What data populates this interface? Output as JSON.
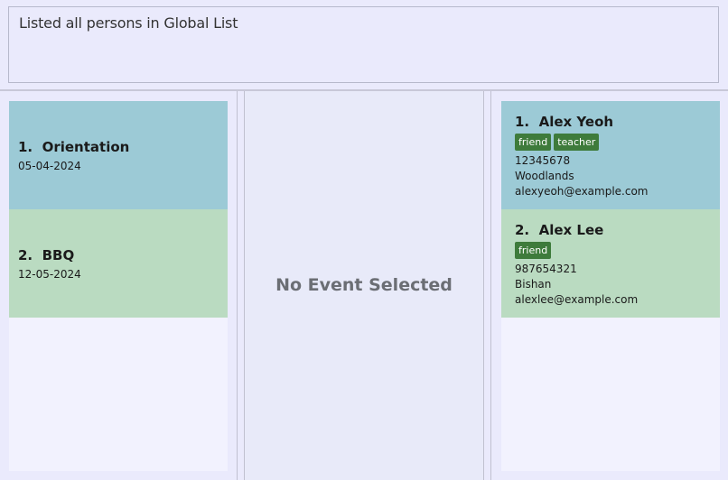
{
  "result_display": {
    "text": "Listed all persons in Global List"
  },
  "events": [
    {
      "index": "1.",
      "name": "Orientation",
      "date": "05-04-2024"
    },
    {
      "index": "2.",
      "name": "BBQ",
      "date": "12-05-2024"
    }
  ],
  "event_detail": {
    "empty_message": "No Event Selected"
  },
  "persons": [
    {
      "index": "1.",
      "name": "Alex Yeoh",
      "tags": [
        "friend",
        "teacher"
      ],
      "phone": "12345678",
      "address": "Woodlands",
      "email": "alexyeoh@example.com"
    },
    {
      "index": "2.",
      "name": "Alex Lee",
      "tags": [
        "friend"
      ],
      "phone": "987654321",
      "address": "Bishan",
      "email": "alexlee@example.com"
    }
  ],
  "colors": {
    "card_blue": "#9ccad6",
    "card_green": "#badbc1",
    "tag_green": "#3e7b3b",
    "background": "#eaeafc"
  }
}
